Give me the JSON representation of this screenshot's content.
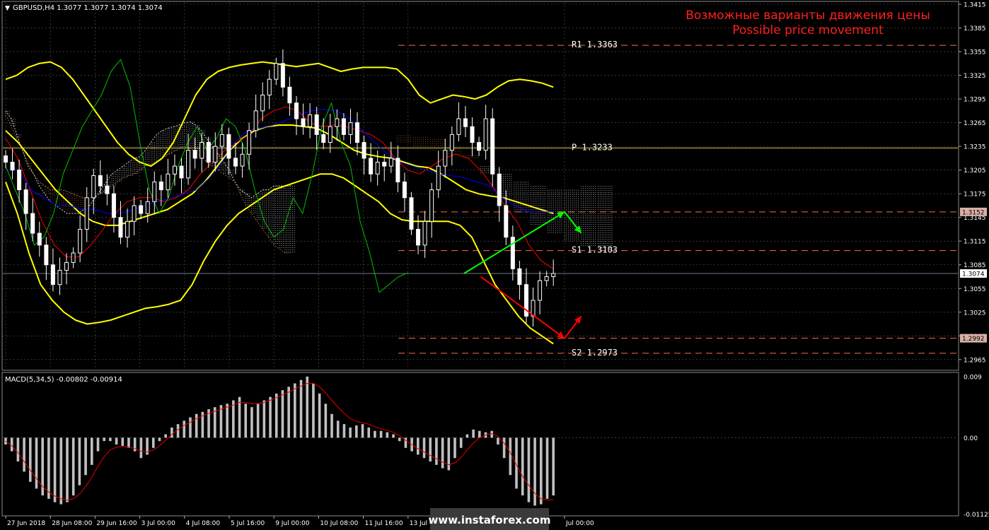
{
  "colors": {
    "background": "#000000",
    "grid": "#ffffff",
    "bull_candle": "#ffffff",
    "bear_candle": "#ffffff",
    "bollinger": "#ffff00",
    "tenkan": "#ff0000",
    "kijun": "#0000ff",
    "chikou": "#00c000",
    "senkou_a": "#ffffff",
    "senkou_b": "#c8783c",
    "levels": "#ff6a4a",
    "pivot": "#d9c64e",
    "title": "#ff2020",
    "text": "#ffffff",
    "macd_hist": "#c0c0c0",
    "macd_signal": "#e00000",
    "forecast_up": "#00ff00",
    "forecast_down": "#ff0000",
    "price_badge_bg": "#ffffff",
    "level_badge_bg": "#d8b0a8"
  },
  "header": {
    "symbol_label": "GBPUSD,H4  1.3077 1.3077 1.3074 1.3074",
    "title_ru": "Возможные варианты движения цены",
    "title_en": "Possible price movement"
  },
  "macd_label": "MACD(5,34,5) -0.00802 -0.00914",
  "watermark": "www.instaforex.com",
  "levels": [
    {
      "label": "R1  1.3363",
      "price": 1.3363,
      "style": "dashed"
    },
    {
      "label": "P  1.3233",
      "price": 1.3233,
      "style": "solid"
    },
    {
      "label": "",
      "price": 1.3152,
      "style": "dashed"
    },
    {
      "label": "S1  1.3103",
      "price": 1.3103,
      "style": "dashed"
    },
    {
      "label": "",
      "price": 1.2992,
      "style": "dashed"
    },
    {
      "label": "S2  1.2973",
      "price": 1.2973,
      "style": "dashed"
    }
  ],
  "price_badges": [
    {
      "text": "1.3152",
      "price": 1.3152,
      "kind": "level"
    },
    {
      "text": "1.3074",
      "price": 1.3074,
      "kind": "current"
    },
    {
      "text": "1.2992",
      "price": 1.2992,
      "kind": "level"
    }
  ],
  "chart_data": {
    "type": "candlestick",
    "symbol": "GBPUSD",
    "timeframe": "H4",
    "ylim": [
      1.2955,
      1.3415
    ],
    "y_ticks": [
      "1.3415",
      "1.3385",
      "1.3355",
      "1.3325",
      "1.3295",
      "1.3265",
      "1.3235",
      "1.3205",
      "1.3175",
      "1.3145",
      "1.3115",
      "1.3085",
      "1.3055",
      "1.3025",
      "1.2995",
      "1.2965"
    ],
    "x_ticks": [
      {
        "label": "27 Jun 2018",
        "i": 0
      },
      {
        "label": "28 Jun 08:00",
        "i": 8
      },
      {
        "label": "29 Jun 16:00",
        "i": 16
      },
      {
        "label": "3 Jul 00:00",
        "i": 24
      },
      {
        "label": "4 Jul 08:00",
        "i": 32
      },
      {
        "label": "5 Jul 16:00",
        "i": 40
      },
      {
        "label": "9 Jul 00:00",
        "i": 48
      },
      {
        "label": "10 Jul 08:00",
        "i": 56
      },
      {
        "label": "11 Jul 16:00",
        "i": 64
      },
      {
        "label": "13 Jul 0",
        "i": 72
      },
      {
        "label": "Jul 00:00",
        "i": 100
      }
    ],
    "close": [
      1.3215,
      1.3205,
      1.318,
      1.315,
      1.3125,
      1.311,
      1.3085,
      1.306,
      1.3078,
      1.3088,
      1.31,
      1.313,
      1.317,
      1.3198,
      1.3185,
      1.3175,
      1.3145,
      1.312,
      1.314,
      1.316,
      1.315,
      1.3165,
      1.319,
      1.318,
      1.32,
      1.321,
      1.3195,
      1.323,
      1.322,
      1.324,
      1.3215,
      1.3235,
      1.325,
      1.322,
      1.321,
      1.3225,
      1.3255,
      1.328,
      1.33,
      1.332,
      1.334,
      1.331,
      1.329,
      1.327,
      1.326,
      1.3275,
      1.325,
      1.324,
      1.326,
      1.327,
      1.325,
      1.3265,
      1.324,
      1.322,
      1.32,
      1.3215,
      1.321,
      1.322,
      1.319,
      1.317,
      1.313,
      1.311,
      1.314,
      1.318,
      1.321,
      1.323,
      1.325,
      1.327,
      1.326,
      1.324,
      1.323,
      1.327,
      1.32,
      1.316,
      1.312,
      1.308,
      1.306,
      1.302,
      1.304,
      1.3065,
      1.307,
      1.3074
    ],
    "high_offset": 0.0018,
    "low_offset": 0.0018,
    "bollinger_upper": [
      1.332,
      1.3325,
      1.3335,
      1.334,
      1.3342,
      1.3335,
      1.332,
      1.33,
      1.328,
      1.326,
      1.324,
      1.3225,
      1.3215,
      1.321,
      1.322,
      1.324,
      1.327,
      1.33,
      1.332,
      1.333,
      1.3335,
      1.3338,
      1.334,
      1.3342,
      1.334,
      1.3338,
      1.3336,
      1.3338,
      1.334,
      1.3335,
      1.333,
      1.3333,
      1.3335,
      1.3335,
      1.3335,
      1.3333,
      1.332,
      1.33,
      1.329,
      1.3295,
      1.33,
      1.3298,
      1.3295,
      1.33,
      1.331,
      1.3318,
      1.332,
      1.3318,
      1.3315,
      1.331
    ],
    "bollinger_mid": [
      1.3255,
      1.324,
      1.322,
      1.32,
      1.318,
      1.3165,
      1.315,
      1.314,
      1.3135,
      1.3135,
      1.314,
      1.3145,
      1.315,
      1.3155,
      1.3165,
      1.3175,
      1.319,
      1.321,
      1.323,
      1.3245,
      1.3255,
      1.326,
      1.3262,
      1.3262,
      1.326,
      1.3258,
      1.325,
      1.324,
      1.323,
      1.3225,
      1.3222,
      1.322,
      1.3215,
      1.321,
      1.3208,
      1.32,
      1.319,
      1.318,
      1.3175,
      1.3172,
      1.317,
      1.3165,
      1.316,
      1.3155,
      1.315
    ],
    "bollinger_lower": [
      1.319,
      1.315,
      1.31,
      1.306,
      1.304,
      1.3025,
      1.3015,
      1.301,
      1.3012,
      1.3015,
      1.302,
      1.3025,
      1.303,
      1.3032,
      1.3035,
      1.304,
      1.306,
      1.309,
      1.3115,
      1.3135,
      1.315,
      1.316,
      1.317,
      1.318,
      1.3185,
      1.319,
      1.3195,
      1.32,
      1.32,
      1.3195,
      1.3185,
      1.3175,
      1.3165,
      1.315,
      1.3142,
      1.314,
      1.314,
      1.314,
      1.314,
      1.3135,
      1.312,
      1.309,
      1.306,
      1.304,
      1.302,
      1.3005,
      1.2995,
      1.2985
    ],
    "tenkan": [
      1.3245,
      1.322,
      1.318,
      1.314,
      1.311,
      1.3095,
      1.3095,
      1.311,
      1.313,
      1.315,
      1.3165,
      1.317,
      1.317,
      1.3165,
      1.317,
      1.318,
      1.32,
      1.3215,
      1.323,
      1.324,
      1.325,
      1.327,
      1.328,
      1.3285,
      1.328,
      1.3265,
      1.326,
      1.3262,
      1.326,
      1.3255,
      1.325,
      1.324,
      1.322,
      1.3205,
      1.32,
      1.321,
      1.322,
      1.3225,
      1.322,
      1.3205,
      1.3185,
      1.316,
      1.314,
      1.311,
      1.309,
      1.308
    ],
    "kijun": [
      1.3205,
      1.3205,
      1.318,
      1.317,
      1.316,
      1.316,
      1.3155,
      1.3155,
      1.315,
      1.315,
      1.3155,
      1.316,
      1.3165,
      1.317,
      1.3175,
      1.318,
      1.3195,
      1.3215,
      1.324,
      1.3255,
      1.3258,
      1.3262,
      1.3268,
      1.3275,
      1.328,
      1.3282,
      1.328,
      1.327,
      1.3255,
      1.324,
      1.3225,
      1.3215,
      1.321,
      1.3205,
      1.32,
      1.3198,
      1.3195,
      1.319,
      1.3185,
      1.317,
      1.316,
      1.3152,
      1.3152,
      1.3152
    ],
    "chikou": [
      1.321,
      1.318,
      1.315,
      1.311,
      1.312,
      1.315,
      1.32,
      1.323,
      1.326,
      1.328,
      1.33,
      1.333,
      1.3345,
      1.331,
      1.324,
      1.318,
      1.315,
      1.317,
      1.321,
      1.324,
      1.326,
      1.323,
      1.3245,
      1.327,
      1.326,
      1.323,
      1.318,
      1.314,
      1.312,
      1.313,
      1.317,
      1.315,
      1.32,
      1.326,
      1.329,
      1.324,
      1.321,
      1.314,
      1.31,
      1.305,
      1.306,
      1.307,
      1.3075
    ],
    "senkou_a": [
      1.328,
      1.327,
      1.325,
      1.323,
      1.321,
      1.32,
      1.3185,
      1.3175,
      1.3165,
      1.316,
      1.3155,
      1.315,
      1.315,
      1.315,
      1.3155,
      1.316,
      1.317,
      1.318,
      1.319,
      1.32,
      1.3205,
      1.321,
      1.3215,
      1.322,
      1.3222,
      1.323,
      1.324,
      1.325,
      1.3255,
      1.3258,
      1.326,
      1.3262,
      1.3265,
      1.3266,
      1.3262,
      1.3255,
      1.3245,
      1.3235,
      1.3225,
      1.3215,
      1.3205,
      1.319,
      1.318,
      1.3175,
      1.317,
      1.3175,
      1.318,
      1.318,
      1.3185,
      1.3185,
      1.3185,
      1.3185
    ],
    "senkou_b": [
      1.3275,
      1.326,
      1.3245,
      1.323,
      1.3215,
      1.32,
      1.319,
      1.3185,
      1.318,
      1.318,
      1.318,
      1.3178,
      1.3175,
      1.3172,
      1.317,
      1.317,
      1.3172,
      1.3175,
      1.318,
      1.3185,
      1.319,
      1.3195,
      1.3198,
      1.32,
      1.3205,
      1.321,
      1.3212,
      1.3215,
      1.322,
      1.3225,
      1.3228,
      1.3232,
      1.3235,
      1.3232,
      1.3228,
      1.3222,
      1.3215,
      1.321,
      1.3205,
      1.32,
      1.3195,
      1.319,
      1.3175,
      1.316,
      1.315,
      1.314,
      1.313,
      1.312,
      1.311,
      1.3105,
      1.31,
      1.31
    ],
    "forecast_up": [
      {
        "i": 82,
        "price": 1.3074
      },
      {
        "i": 100,
        "price": 1.3152
      },
      {
        "i": 103,
        "price": 1.3125
      }
    ],
    "forecast_down": [
      {
        "i": 85,
        "price": 1.307
      },
      {
        "i": 100,
        "price": 1.2992
      },
      {
        "i": 103,
        "price": 1.302
      }
    ],
    "macd": {
      "ylim": [
        -0.0113,
        0.0093
      ],
      "y_ticks": [
        "0.009",
        "0.00",
        "-0.01125"
      ],
      "hist": [
        -0.001,
        -0.002,
        -0.0035,
        -0.005,
        -0.0065,
        -0.0075,
        -0.0085,
        -0.009,
        -0.0095,
        -0.0098,
        -0.0095,
        -0.0085,
        -0.007,
        -0.0055,
        -0.004,
        -0.002,
        -0.0005,
        -0.0005,
        -0.001,
        -0.0012,
        -0.0015,
        -0.002,
        -0.003,
        -0.0025,
        -0.0015,
        -0.0005,
        0.0005,
        0.0015,
        0.002,
        0.0025,
        0.003,
        0.0035,
        0.0038,
        0.0042,
        0.0045,
        0.0048,
        0.005,
        0.0055,
        0.006,
        0.005,
        0.0045,
        0.005,
        0.0055,
        0.006,
        0.0065,
        0.007,
        0.0075,
        0.008,
        0.0085,
        0.009,
        0.008,
        0.0065,
        0.005,
        0.0035,
        0.0025,
        0.002,
        0.0015,
        0.0018,
        0.002,
        0.0015,
        0.001,
        0.001,
        0.0008,
        0.0005,
        -0.0005,
        -0.0015,
        -0.002,
        -0.0025,
        -0.003,
        -0.0035,
        -0.004,
        -0.0045,
        -0.0048,
        -0.003,
        -0.0015,
        0.0005,
        0.0012,
        0.001,
        0.0008,
        0.001,
        -0.001,
        -0.003,
        -0.0055,
        -0.0075,
        -0.0085,
        -0.0095,
        -0.01,
        -0.0098,
        -0.009,
        -0.0085
      ],
      "signal": [
        -0.0005,
        -0.0012,
        -0.0022,
        -0.0035,
        -0.0048,
        -0.006,
        -0.0072,
        -0.008,
        -0.0086,
        -0.009,
        -0.0092,
        -0.009,
        -0.0083,
        -0.0072,
        -0.0058,
        -0.0042,
        -0.0028,
        -0.0018,
        -0.0014,
        -0.0013,
        -0.0014,
        -0.0016,
        -0.002,
        -0.0021,
        -0.0018,
        -0.0012,
        -0.0004,
        0.0005,
        0.0012,
        0.0018,
        0.0023,
        0.0028,
        0.0032,
        0.0036,
        0.0039,
        0.0042,
        0.0045,
        0.0048,
        0.0052,
        0.0052,
        0.005,
        0.005,
        0.0052,
        0.0055,
        0.0059,
        0.0063,
        0.0067,
        0.0072,
        0.0076,
        0.008,
        0.008,
        0.0075,
        0.0066,
        0.0055,
        0.0045,
        0.0036,
        0.0028,
        0.0024,
        0.0022,
        0.002,
        0.0016,
        0.0013,
        0.0011,
        0.0008,
        0.0003,
        -0.0004,
        -0.001,
        -0.0016,
        -0.0021,
        -0.0026,
        -0.0031,
        -0.0036,
        -0.004,
        -0.0037,
        -0.0029,
        -0.0018,
        -0.0008,
        0.0,
        0.0004,
        0.0006,
        0.0002,
        -0.0008,
        -0.0022,
        -0.004,
        -0.0057,
        -0.007,
        -0.0082,
        -0.009,
        -0.0092,
        -0.0091
      ]
    }
  }
}
